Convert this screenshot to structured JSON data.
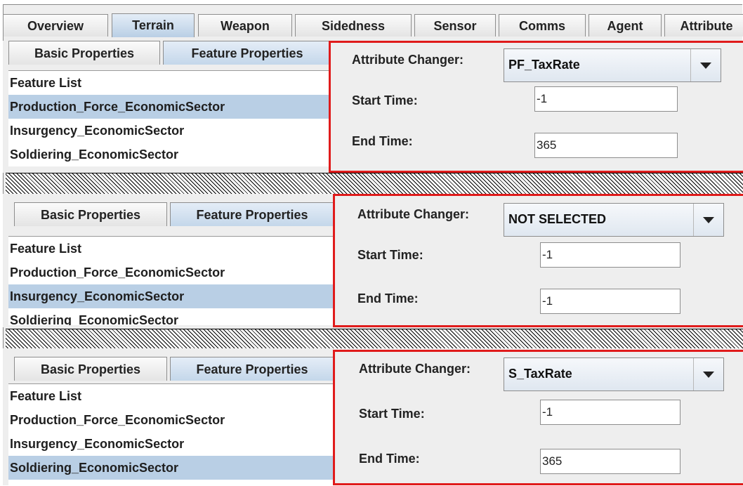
{
  "main_tabs": [
    {
      "label": "Overview",
      "active": false
    },
    {
      "label": "Terrain",
      "active": true
    },
    {
      "label": "Weapon",
      "active": false
    },
    {
      "label": "Sidedness",
      "active": false
    },
    {
      "label": "Sensor",
      "active": false
    },
    {
      "label": "Comms",
      "active": false
    },
    {
      "label": "Agent",
      "active": false
    },
    {
      "label": "Attribute",
      "active": false
    }
  ],
  "sections": [
    {
      "subtabs": [
        {
          "label": "Basic Properties",
          "active": false
        },
        {
          "label": "Feature Properties",
          "active": true
        }
      ],
      "list_header": "Feature List",
      "items": [
        {
          "label": "Production_Force_EconomicSector",
          "selected": true
        },
        {
          "label": "Insurgency_EconomicSector",
          "selected": false
        },
        {
          "label": "Soldiering_EconomicSector",
          "selected": false
        }
      ],
      "attribute_changer_label": "Attribute Changer:",
      "attribute_changer_value": "PF_TaxRate",
      "start_time_label": "Start Time:",
      "start_time_value": "-1",
      "end_time_label": "End Time:",
      "end_time_value": "365"
    },
    {
      "subtabs": [
        {
          "label": "Basic Properties",
          "active": false
        },
        {
          "label": "Feature Properties",
          "active": true
        }
      ],
      "list_header": "Feature List",
      "items": [
        {
          "label": "Production_Force_EconomicSector",
          "selected": false
        },
        {
          "label": "Insurgency_EconomicSector",
          "selected": true
        },
        {
          "label": "Soldiering_EconomicSector",
          "selected": false
        }
      ],
      "attribute_changer_label": "Attribute Changer:",
      "attribute_changer_value": "NOT SELECTED",
      "start_time_label": "Start Time:",
      "start_time_value": "-1",
      "end_time_label": "End Time:",
      "end_time_value": "-1"
    },
    {
      "subtabs": [
        {
          "label": "Basic Properties",
          "active": false
        },
        {
          "label": "Feature Properties",
          "active": true
        }
      ],
      "list_header": "Feature List",
      "items": [
        {
          "label": "Production_Force_EconomicSector",
          "selected": false
        },
        {
          "label": "Insurgency_EconomicSector",
          "selected": false
        },
        {
          "label": "Soldiering_EconomicSector",
          "selected": true
        }
      ],
      "attribute_changer_label": "Attribute Changer:",
      "attribute_changer_value": "S_TaxRate",
      "start_time_label": "Start Time:",
      "start_time_value": "-1",
      "end_time_label": "End Time:",
      "end_time_value": "365"
    }
  ],
  "colors": {
    "selection": "#b9cfe5",
    "highlight_border": "#e01b1b"
  },
  "icons": {
    "dropdown": "chevron-down-icon"
  }
}
